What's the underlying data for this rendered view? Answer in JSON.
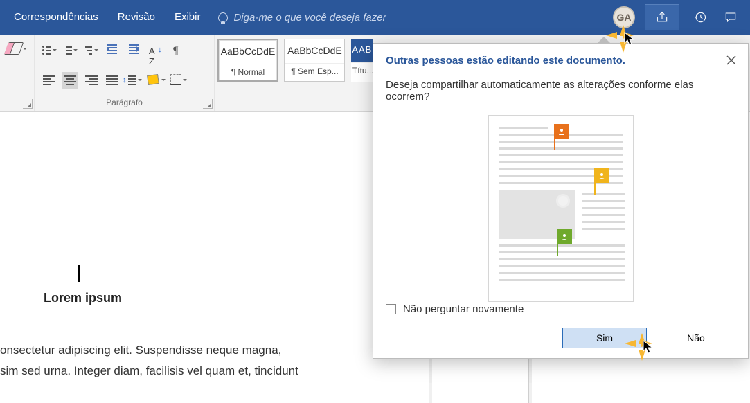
{
  "titlebar": {
    "tabs": [
      "Correspondências",
      "Revisão",
      "Exibir"
    ],
    "search_placeholder": "Diga-me o que você deseja fazer",
    "avatar": "GA"
  },
  "ribbon": {
    "paragraph_label": "Parágrafo",
    "styles": [
      {
        "preview": "AaBbCcDdE",
        "name": "¶ Normal"
      },
      {
        "preview": "AaBbCcDdE",
        "name": "¶ Sem Esp..."
      },
      {
        "preview": "AAB",
        "name": "Títu..."
      }
    ]
  },
  "document": {
    "heading": "Lorem ipsum",
    "body_line1": "onsectetur adipiscing elit. Suspendisse neque magna,",
    "body_line2": "sim sed urna. Integer diam, facilisis vel quam et, tincidunt"
  },
  "dialog": {
    "title": "Outras pessoas estão editando este documento.",
    "body": "Deseja compartilhar automaticamente as alterações conforme elas ocorrem?",
    "checkbox": "Não perguntar novamente",
    "yes": "Sim",
    "no": "Não"
  }
}
